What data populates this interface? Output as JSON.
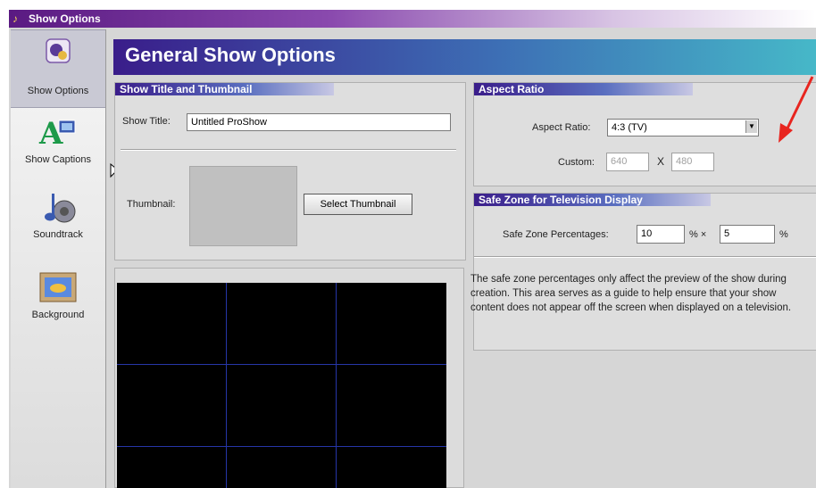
{
  "window": {
    "title": "Show Options",
    "title_icon": "show-options-icon"
  },
  "sidebar": {
    "items": [
      {
        "label": "Show Options",
        "icon": "show-options-icon",
        "active": true
      },
      {
        "label": "Show Captions",
        "icon": "captions-icon",
        "active": false
      },
      {
        "label": "Soundtrack",
        "icon": "soundtrack-icon",
        "active": false
      },
      {
        "label": "Background",
        "icon": "background-icon",
        "active": false
      }
    ]
  },
  "header": {
    "title": "General Show Options"
  },
  "title_section": {
    "heading": "Show Title and Thumbnail",
    "show_title_label": "Show Title:",
    "show_title_value": "Untitled ProShow",
    "thumbnail_label": "Thumbnail:",
    "select_thumbnail_button": "Select Thumbnail"
  },
  "aspect_section": {
    "heading": "Aspect Ratio",
    "aspect_label": "Aspect Ratio:",
    "aspect_value": "4:3 (TV)",
    "custom_label": "Custom:",
    "custom_width": "640",
    "times_symbol": "X",
    "custom_height": "480"
  },
  "safe_zone_section": {
    "heading": "Safe Zone for Television Display",
    "percentages_label": "Safe Zone Percentages:",
    "value_1": "10",
    "percent_times": "% ×",
    "value_2": "5",
    "percent_symbol": "%",
    "description": "The safe zone percentages only affect the preview of the show during creation. This area serves as a guide to help ensure that your show content does not appear off the screen when displayed on a television."
  },
  "colors": {
    "title_bar": "#5a1a82",
    "header_start": "#3a1d8a",
    "header_end": "#46b8c8",
    "annotation_arrow": "#e8251f",
    "grid_lines": "#2636a8"
  }
}
